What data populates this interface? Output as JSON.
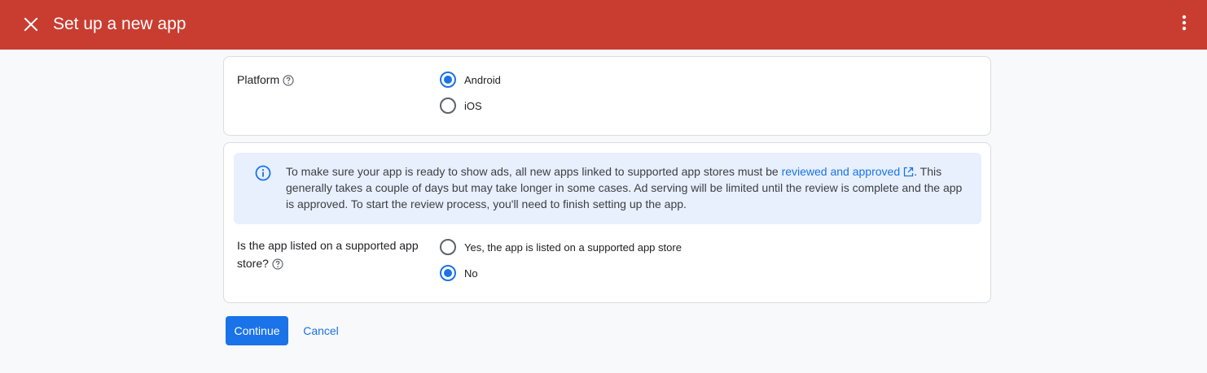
{
  "header": {
    "title": "Set up a new app",
    "close_icon": "close-icon",
    "more_icon": "more-vert-icon",
    "background_color": "#c93d31"
  },
  "platform": {
    "label": "Platform",
    "options": [
      {
        "label": "Android",
        "selected": true
      },
      {
        "label": "iOS",
        "selected": false
      }
    ]
  },
  "info": {
    "text_before": "To make sure your app is ready to show ads, all new apps linked to supported app stores must be ",
    "link_text": "reviewed and approved",
    "text_after": ". This generally takes a couple of days but may take longer in some cases. Ad serving will be limited until the review is complete and the app is approved. To start the review process, you'll need to finish setting up the app.",
    "icon": "info-icon",
    "background_color": "#e8f0fe"
  },
  "store": {
    "label": "Is the app listed on a supported app store?",
    "options": [
      {
        "label": "Yes, the app is listed on a supported app store",
        "selected": false
      },
      {
        "label": "No",
        "selected": true
      }
    ]
  },
  "actions": {
    "continue_label": "Continue",
    "cancel_label": "Cancel",
    "accent_color": "#1a73e8"
  }
}
